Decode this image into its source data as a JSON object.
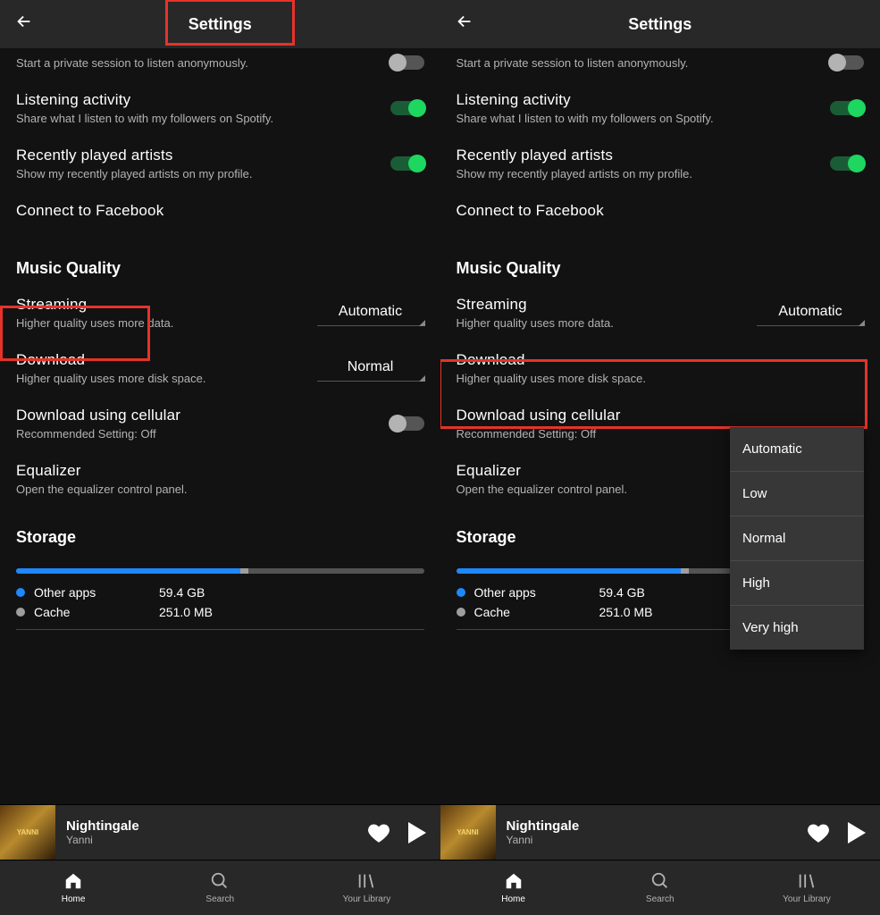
{
  "header": {
    "title": "Settings"
  },
  "partialRow": {
    "sub": "Start a private session to listen anonymously."
  },
  "rows": {
    "listening": {
      "title": "Listening activity",
      "sub": "Share what I listen to with my followers on Spotify."
    },
    "recent": {
      "title": "Recently played artists",
      "sub": "Show my recently played artists on my profile."
    },
    "fb": {
      "title": "Connect to Facebook"
    },
    "streaming": {
      "title": "Streaming",
      "sub": "Higher quality uses more data.",
      "value": "Automatic"
    },
    "download": {
      "title": "Download",
      "sub": "Higher quality uses more disk space.",
      "value": "Normal"
    },
    "cell": {
      "title": "Download using cellular",
      "sub": "Recommended Setting: Off"
    },
    "eq": {
      "title": "Equalizer",
      "sub": "Open the equalizer control panel."
    }
  },
  "sections": {
    "musicQuality": "Music Quality",
    "storage": "Storage"
  },
  "storage": {
    "legend": [
      {
        "label": "Other apps",
        "value": "59.4 GB"
      },
      {
        "label": "Cache",
        "value": "251.0 MB"
      }
    ],
    "bluePct": 55,
    "greyPct": 2
  },
  "dropdownOptions": [
    "Automatic",
    "Low",
    "Normal",
    "High",
    "Very high"
  ],
  "nowPlaying": {
    "title": "Nightingale",
    "artist": "Yanni",
    "thumbText": "YANNI"
  },
  "nav": {
    "home": "Home",
    "search": "Search",
    "library": "Your Library"
  }
}
